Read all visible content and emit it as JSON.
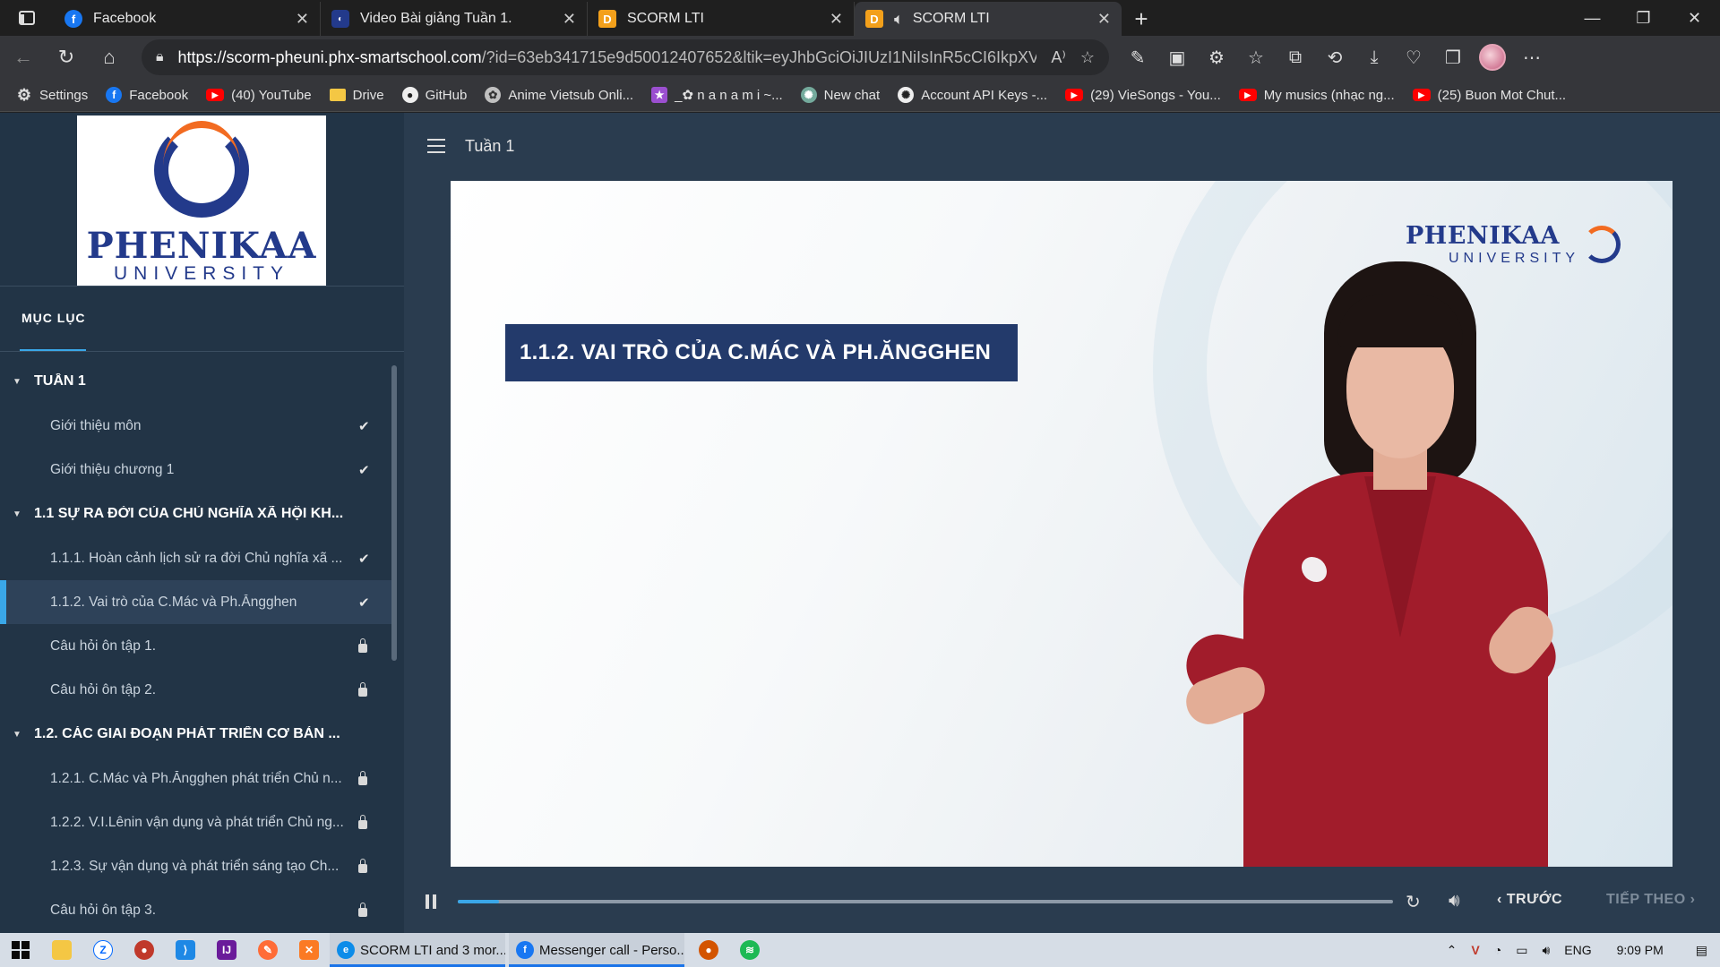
{
  "browser": {
    "tabs": [
      {
        "title": "Facebook",
        "favicon": "facebook-icon",
        "active": false
      },
      {
        "title": "Video Bài giảng Tuần 1.",
        "favicon": "phenikaa-icon",
        "active": false
      },
      {
        "title": "SCORM LTI",
        "favicon": "d-icon",
        "active": false
      },
      {
        "title": "SCORM LTI",
        "favicon": "d-icon",
        "active": true,
        "audio": true
      }
    ],
    "url_host": "https://scorm-pheuni.phx-smartschool.com",
    "url_rest": "/?id=63eb341715e9d50012407652&ltik=eyJhbGciOiJIUzI1NiIsInR5cCI6IkpXVC...",
    "bookmarks": [
      {
        "label": "Settings",
        "icon": "gear-icon"
      },
      {
        "label": "Facebook",
        "icon": "facebook-icon"
      },
      {
        "label": "(40) YouTube",
        "icon": "youtube-icon"
      },
      {
        "label": "Drive",
        "icon": "folder-icon"
      },
      {
        "label": "GitHub",
        "icon": "github-icon"
      },
      {
        "label": "Anime Vietsub Onli...",
        "icon": "anime-icon"
      },
      {
        "label": "_✿ n a n a m i ~...",
        "icon": "nanami-icon"
      },
      {
        "label": "New chat",
        "icon": "chatgpt-icon"
      },
      {
        "label": "Account API Keys -...",
        "icon": "openai-icon"
      },
      {
        "label": "(29) VieSongs - You...",
        "icon": "youtube-icon"
      },
      {
        "label": "My musics (nhạc ng...",
        "icon": "youtube-icon"
      },
      {
        "label": "(25) Buon Mot Chut...",
        "icon": "youtube-icon"
      }
    ]
  },
  "sidebar": {
    "logo_name": "PHENIKAA",
    "logo_sub": "UNIVERSITY",
    "toc_tab": "MỤC LỤC",
    "sections": [
      {
        "title": "TUẦN 1",
        "items": [
          {
            "title": "Giới thiệu môn",
            "state": "done"
          },
          {
            "title": "Giới thiệu chương 1",
            "state": "done"
          }
        ]
      },
      {
        "title": "1.1 SỰ RA ĐỜI CỦA CHỦ NGHĨA XÃ HỘI KH...",
        "items": [
          {
            "title": "1.1.1. Hoàn cảnh lịch sử ra đời Chủ nghĩa xã ...",
            "state": "done"
          },
          {
            "title": "1.1.2. Vai trò của C.Mác và Ph.Ăngghen",
            "state": "done",
            "active": true
          },
          {
            "title": "Câu hỏi ôn tập 1.",
            "state": "locked"
          },
          {
            "title": "Câu hỏi ôn tập 2.",
            "state": "locked"
          }
        ]
      },
      {
        "title": "1.2. CÁC GIAI ĐOẠN PHÁT TRIỂN CƠ BẢN ...",
        "items": [
          {
            "title": "1.2.1. C.Mác và Ph.Ăngghen phát triển Chủ n...",
            "state": "locked"
          },
          {
            "title": "1.2.2. V.I.Lênin vận dụng và phát triển Chủ ng...",
            "state": "locked"
          },
          {
            "title": "1.2.3. Sự vận dụng và phát triển sáng tạo Ch...",
            "state": "locked"
          },
          {
            "title": "Câu hỏi ôn tập 3.",
            "state": "locked"
          }
        ]
      }
    ]
  },
  "main": {
    "week_title": "Tuần 1",
    "slide_title": "1.1.2. VAI TRÒ CỦA C.MÁC VÀ PH.ĂNGGHEN",
    "video_logo_name": "PHENIKAA",
    "video_logo_sub": "UNIVERSITY",
    "progress_fraction": 0.044,
    "prev_label": "TRƯỚC",
    "next_label": "TIẾP THEO"
  },
  "taskbar": {
    "tasks": [
      {
        "label": "SCORM LTI and 3 mor...",
        "icon": "edge-icon"
      },
      {
        "label": "Messenger call - Perso...",
        "icon": "facebook-icon"
      }
    ],
    "language": "ENG",
    "time": "9:09 PM"
  },
  "colors": {
    "accent": "#3aa7e8",
    "sidebar_bg": "#223446",
    "page_bg": "#2a3c4f",
    "slide_title_bg": "#233a6b",
    "brand_blue": "#233a8b",
    "brand_orange": "#f26b21"
  }
}
